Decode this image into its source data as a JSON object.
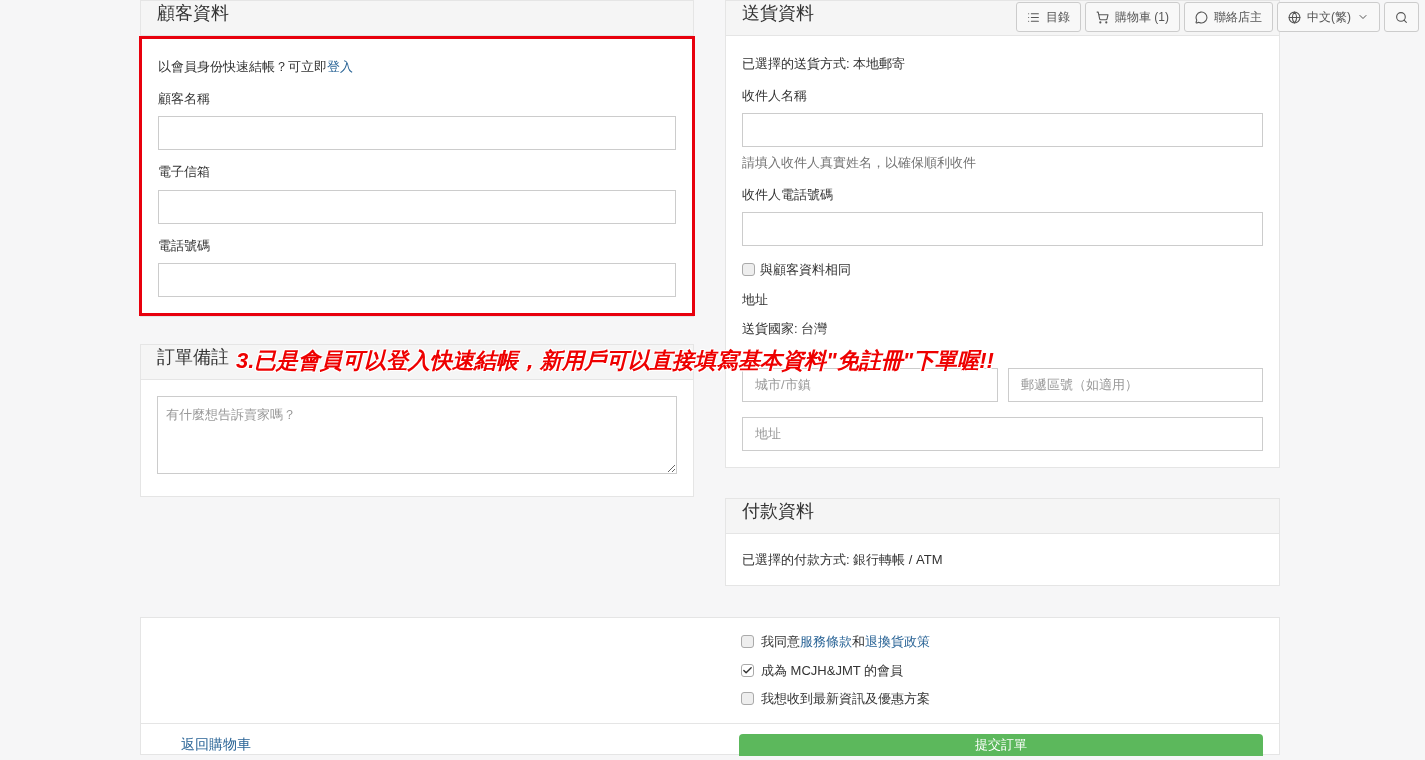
{
  "customer": {
    "title": "顧客資料",
    "highlighted": true,
    "login_prompt": "以會員身份快速結帳？可立即",
    "login_link": "登入",
    "fields": [
      {
        "label": "顧客名稱"
      },
      {
        "label": "電子信箱"
      },
      {
        "label": "電話號碼"
      }
    ]
  },
  "notes": {
    "title": "訂單備註",
    "placeholder": "有什麼想告訴賣家嗎？"
  },
  "shipping": {
    "title": "送貨資料",
    "method": "已選擇的送貨方式: 本地郵寄",
    "fields": [
      {
        "label": "收件人名稱",
        "hint": "請填入收件人真實姓名，以確保順利收件"
      },
      {
        "label": "收件人電話號碼"
      }
    ],
    "same_as_customer": {
      "label": "與顧客資料相同",
      "checked": false
    },
    "address_title": "地址",
    "country": "送貨國家: 台灣",
    "address_fields": [
      {
        "placeholder": "城市/市鎮"
      },
      {
        "placeholder": "郵遞區號（如適用）"
      },
      {
        "placeholder": "地址"
      }
    ]
  },
  "payment": {
    "title": "付款資料",
    "method": "已選擇的付款方式: 銀行轉帳 / ATM"
  },
  "agreements": [
    {
      "checked": false,
      "segments": [
        {
          "text": "我同意",
          "link": false
        },
        {
          "text": "服務條款",
          "link": true
        },
        {
          "text": "和",
          "link": false
        },
        {
          "text": "退換貨政策",
          "link": true
        }
      ]
    },
    {
      "checked": true,
      "segments": [
        {
          "text": "成為 MCJH&JMT 的會員",
          "link": false
        }
      ]
    },
    {
      "checked": false,
      "segments": [
        {
          "text": "我想收到最新資訊及優惠方案",
          "link": false
        }
      ]
    }
  ],
  "footer": {
    "back_link": "返回購物車",
    "submit_button": "提交訂單"
  },
  "nav": [
    {
      "kind": "list",
      "label": "目錄"
    },
    {
      "kind": "cart",
      "label": "購物車 (1)"
    },
    {
      "kind": "chat",
      "label": "聯絡店主"
    },
    {
      "kind": "globe",
      "label": "中文(繁)",
      "dropdown": true
    },
    {
      "kind": "search"
    }
  ],
  "annotation": "3.已是會員可以登入快速結帳，新用戶可以直接填寫基本資料\"免註冊\"下單喔!!"
}
